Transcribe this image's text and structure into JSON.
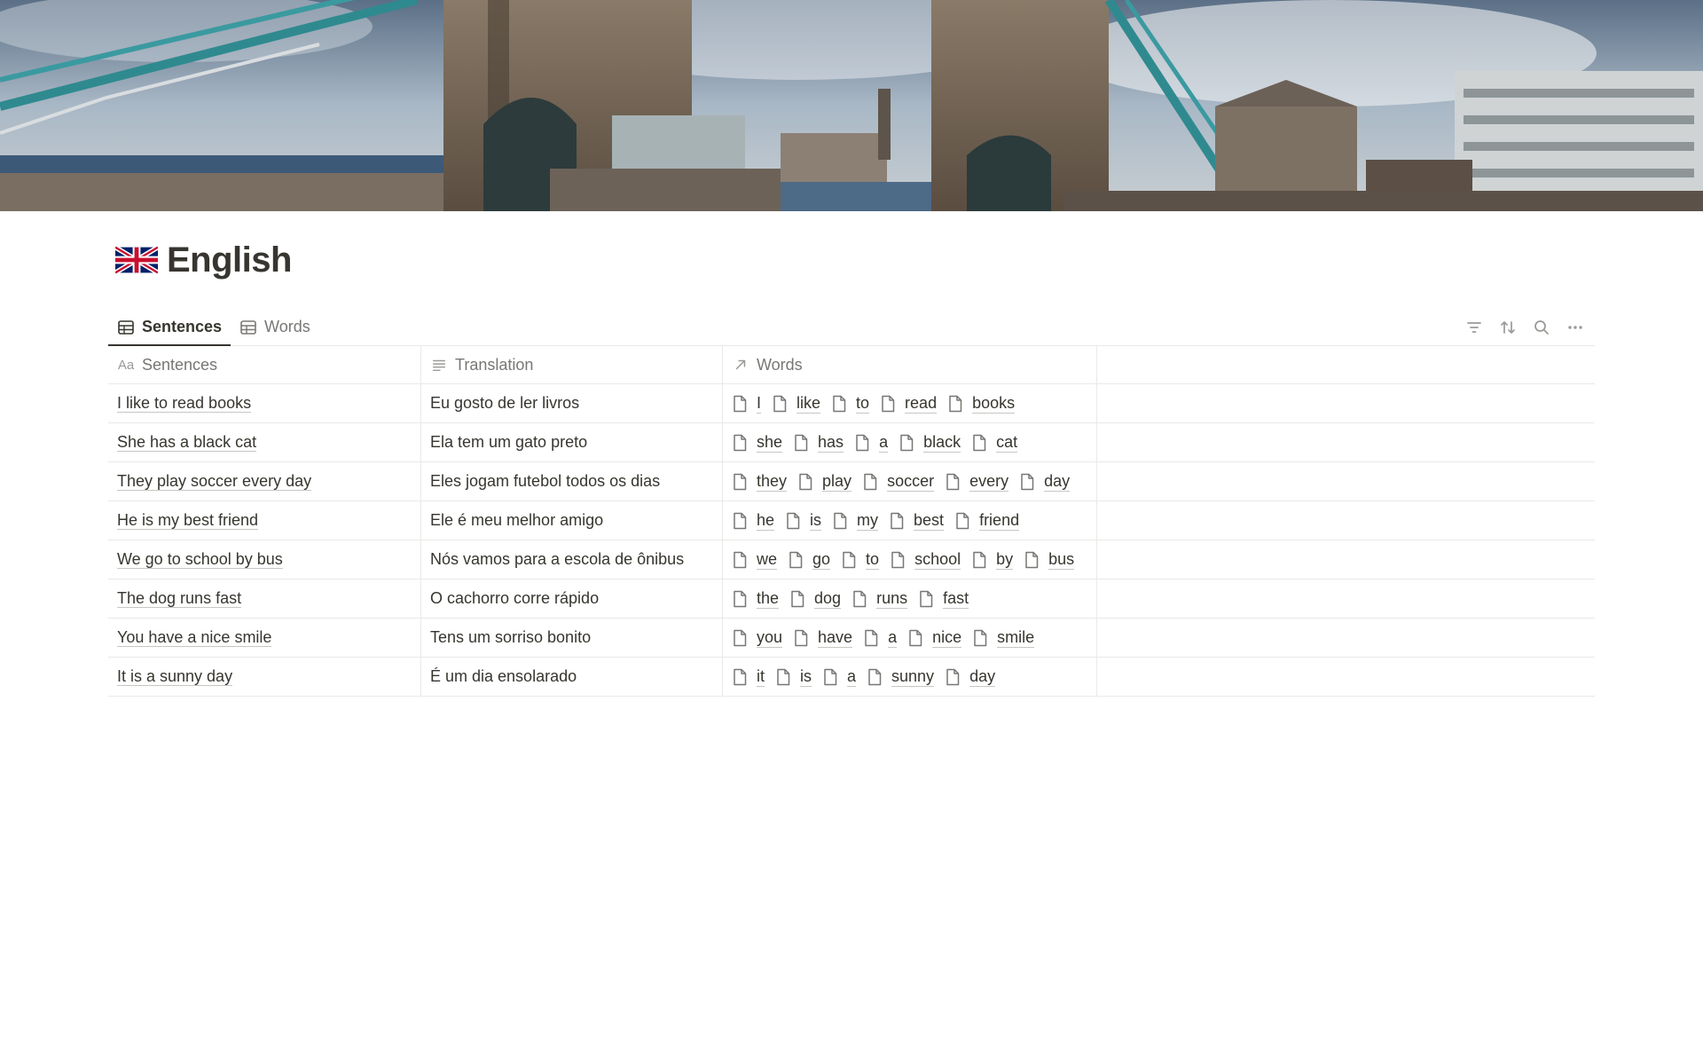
{
  "page": {
    "title": "English",
    "title_icon": "uk-flag-icon"
  },
  "tabs": [
    {
      "label": "Sentences",
      "icon": "table-icon",
      "active": true
    },
    {
      "label": "Words",
      "icon": "table-icon",
      "active": false
    }
  ],
  "toolbar": {
    "icons": [
      "filter-icon",
      "sort-icon",
      "search-icon",
      "more-icon"
    ]
  },
  "table": {
    "columns": [
      {
        "label": "Sentences",
        "icon_text": "Aa"
      },
      {
        "label": "Translation",
        "icon": "text-lines-icon"
      },
      {
        "label": "Words",
        "icon": "relation-arrow-icon"
      }
    ],
    "rows": [
      {
        "sentence": "I like to read books",
        "translation": "Eu gosto de ler livros",
        "words": [
          "I",
          "like",
          "to",
          "read",
          "books"
        ]
      },
      {
        "sentence": "She has a black cat",
        "translation": "Ela tem um gato preto",
        "words": [
          "she",
          "has",
          "a",
          "black",
          "cat"
        ]
      },
      {
        "sentence": "They play soccer every day",
        "translation": "Eles jogam futebol todos os dias",
        "words": [
          "they",
          "play",
          "soccer",
          "every",
          "day"
        ]
      },
      {
        "sentence": "He is my best friend",
        "translation": "Ele é meu melhor amigo",
        "words": [
          "he",
          "is",
          "my",
          "best",
          "friend"
        ]
      },
      {
        "sentence": "We go to school by bus",
        "translation": "Nós vamos para a escola de ônibus",
        "words": [
          "we",
          "go",
          "to",
          "school",
          "by",
          "bus"
        ]
      },
      {
        "sentence": "The dog runs fast",
        "translation": "O cachorro corre rápido",
        "words": [
          "the",
          "dog",
          "runs",
          "fast"
        ]
      },
      {
        "sentence": "You have a nice smile",
        "translation": "Tens um sorriso bonito",
        "words": [
          "you",
          "have",
          "a",
          "nice",
          "smile"
        ]
      },
      {
        "sentence": "It is a sunny day",
        "translation": "É um dia ensolarado",
        "words": [
          "it",
          "is",
          "a",
          "sunny",
          "day"
        ]
      }
    ]
  },
  "colors": {
    "text": "#37352f",
    "muted": "#787774",
    "border": "#e9e9e7"
  }
}
